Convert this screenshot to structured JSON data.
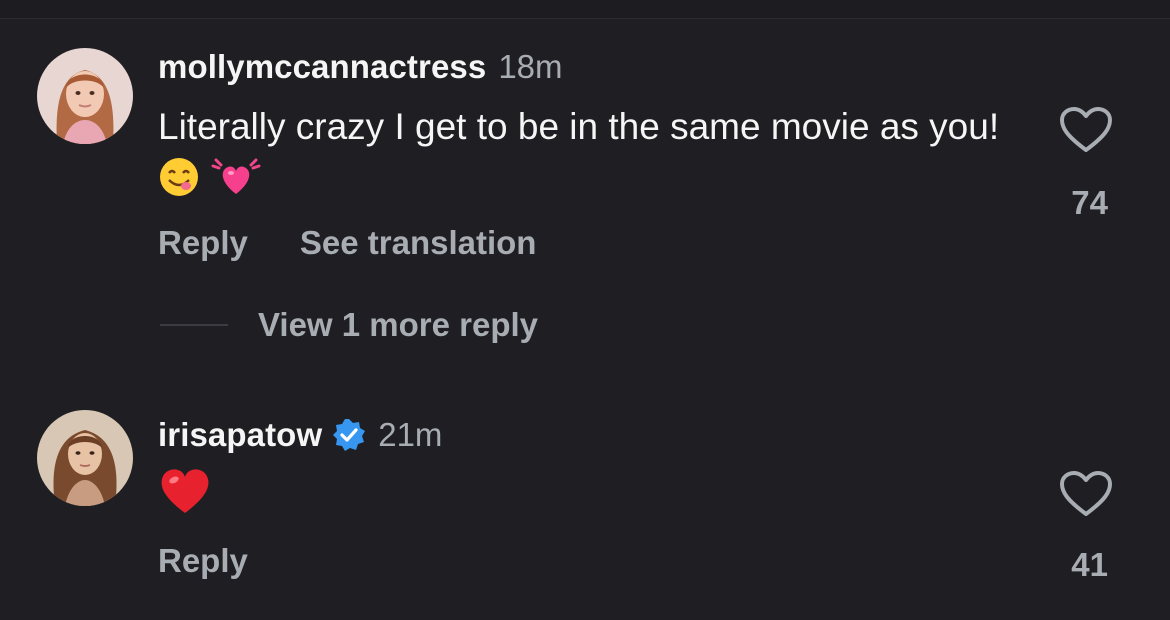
{
  "comments": [
    {
      "username": "mollymccannactress",
      "time": "18m",
      "verified": false,
      "text": "Literally crazy I get to be in the same movie as you!",
      "emojis": [
        "yum-face-emoji",
        "beating-heart-emoji"
      ],
      "actions": {
        "reply": "Reply",
        "translate": "See translation"
      },
      "likes": "74"
    },
    {
      "username": "irisapatow",
      "time": "21m",
      "verified": true,
      "text": "",
      "emojis": [
        "red-heart-emoji"
      ],
      "actions": {
        "reply": "Reply"
      },
      "likes": "41"
    }
  ],
  "thread": {
    "more_replies": "View 1 more reply"
  },
  "colors": {
    "background": "#1f1f23",
    "primary_text": "#f5f5f5",
    "secondary_text": "#a8acb3",
    "verified_blue": "#3797f0"
  }
}
